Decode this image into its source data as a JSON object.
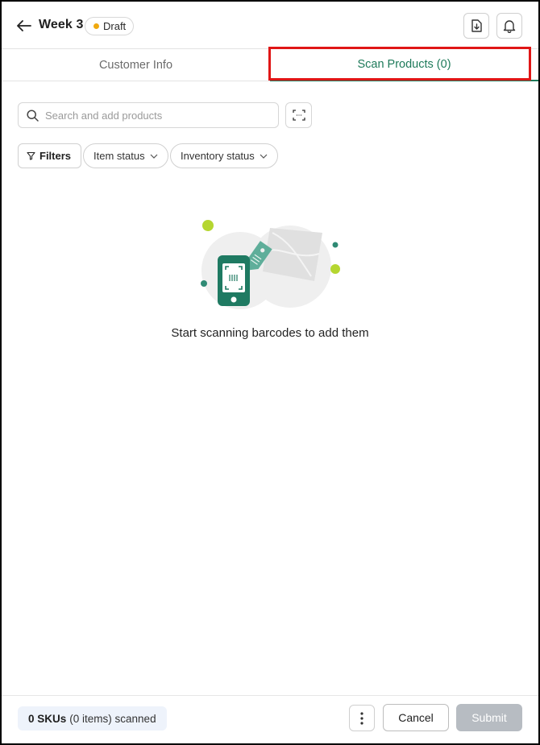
{
  "header": {
    "title": "Week 3",
    "status_label": "Draft",
    "status_color": "#f0a90e",
    "back_icon": "arrow-left-icon",
    "download_icon": "file-download-icon",
    "notification_icon": "bell-icon"
  },
  "tabs": [
    {
      "label": "Customer Info",
      "active": false
    },
    {
      "label": "Scan Products (0)",
      "active": true
    }
  ],
  "search": {
    "placeholder": "Search and add products",
    "value": "",
    "scan_icon": "barcode-scan-icon"
  },
  "filters": {
    "filters_label": "Filters",
    "item_status_label": "Item status",
    "inventory_status_label": "Inventory status"
  },
  "empty_state": {
    "message": "Start scanning barcodes to add them"
  },
  "footer": {
    "skus_count": "0 SKUs",
    "items_text": "(0 items) scanned",
    "cancel_label": "Cancel",
    "submit_label": "Submit",
    "submit_enabled": false
  },
  "colors": {
    "accent": "#1e7a5a",
    "highlight_border": "#e01616",
    "lime": "#b5d630"
  }
}
